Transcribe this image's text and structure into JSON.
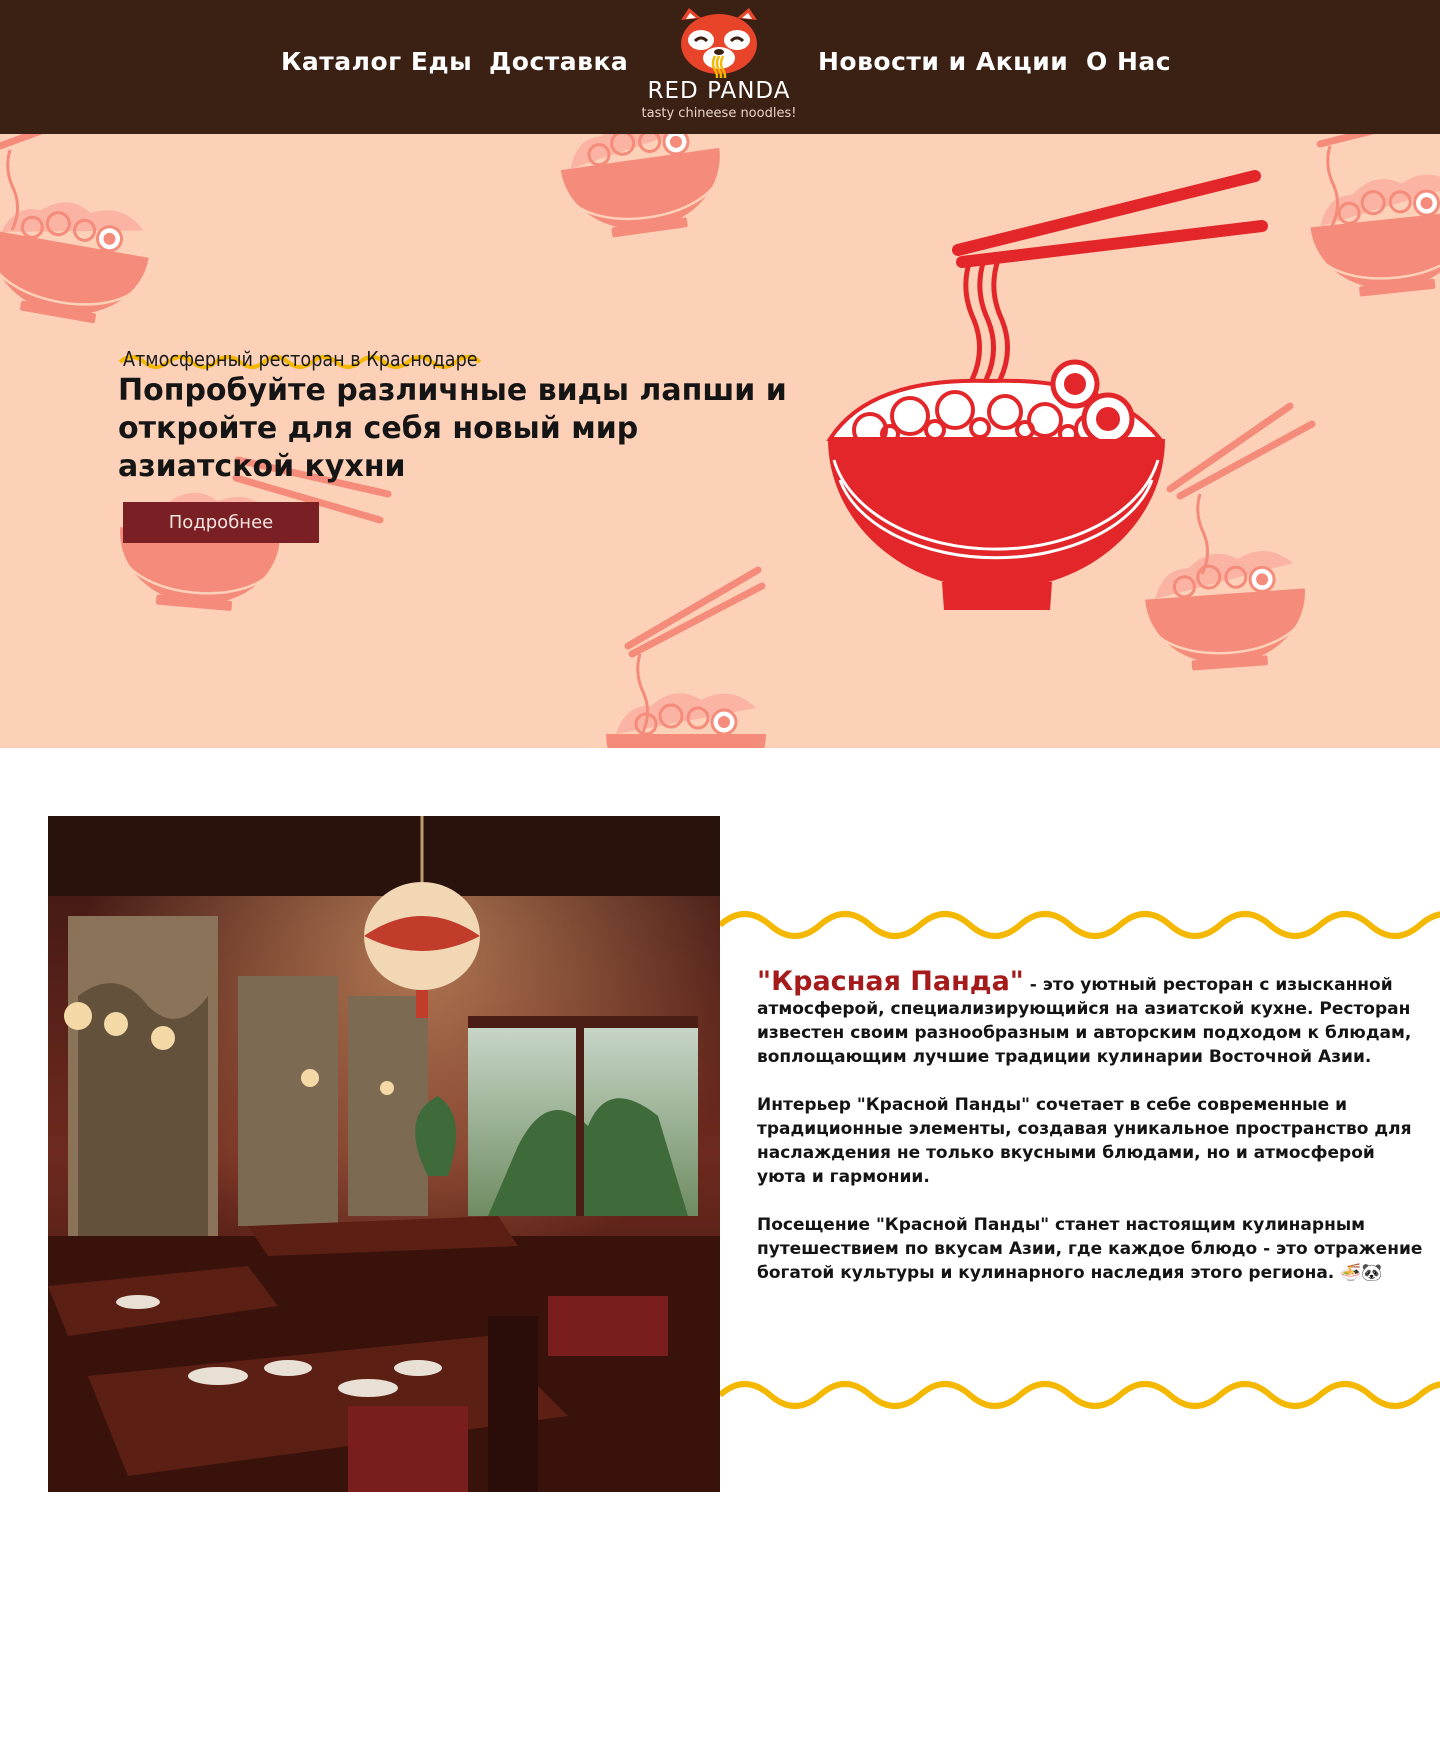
{
  "header": {
    "nav_left": [
      "Каталог Еды",
      "Доставка"
    ],
    "nav_right": [
      "Новости и Акции",
      "О Нас"
    ],
    "logo_title": "RED PANDA",
    "logo_subtitle": "tasty chineese noodles!"
  },
  "hero": {
    "kicker": "Атмосферный ресторан в Краснодаре",
    "title": "Попробуйте различные виды лапши и откройте для себя новый мир азиатской кухни",
    "button_label": "Подробнее"
  },
  "about": {
    "brand": "\"Красная Панда\"",
    "intro": " - это уютный ресторан с изысканной атмосферой, специализирующийся на азиатской кухне. Ресторан известен своим разнообразным и авторским подходом к блюдам, воплощающим лучшие традиции кулинарии Восточной Азии.",
    "paragraph2": "Интерьер \"Красной Панды\" сочетает в себе современные и традиционные элементы, создавая уникальное пространство для наслаждения не только вкусными блюдами, но и атмосферой уюта и гармонии.",
    "paragraph3": "Посещение \"Красной Панды\" станет настоящим кулинарным путешествием по вкусам Азии, где каждое блюдо - это отражение богатой культуры и кулинарного наследия этого региона. 🍜🐼"
  },
  "colors": {
    "header_bg": "#3b2014",
    "hero_bg": "#fdd0b8",
    "accent_red": "#e3262a",
    "button_bg": "#7a1f23",
    "wave_yellow": "#f5b800",
    "brand_red": "#a51b1b"
  },
  "icons": [
    "red-panda-logo-icon",
    "noodle-bowl-icon",
    "chopsticks-icon"
  ]
}
